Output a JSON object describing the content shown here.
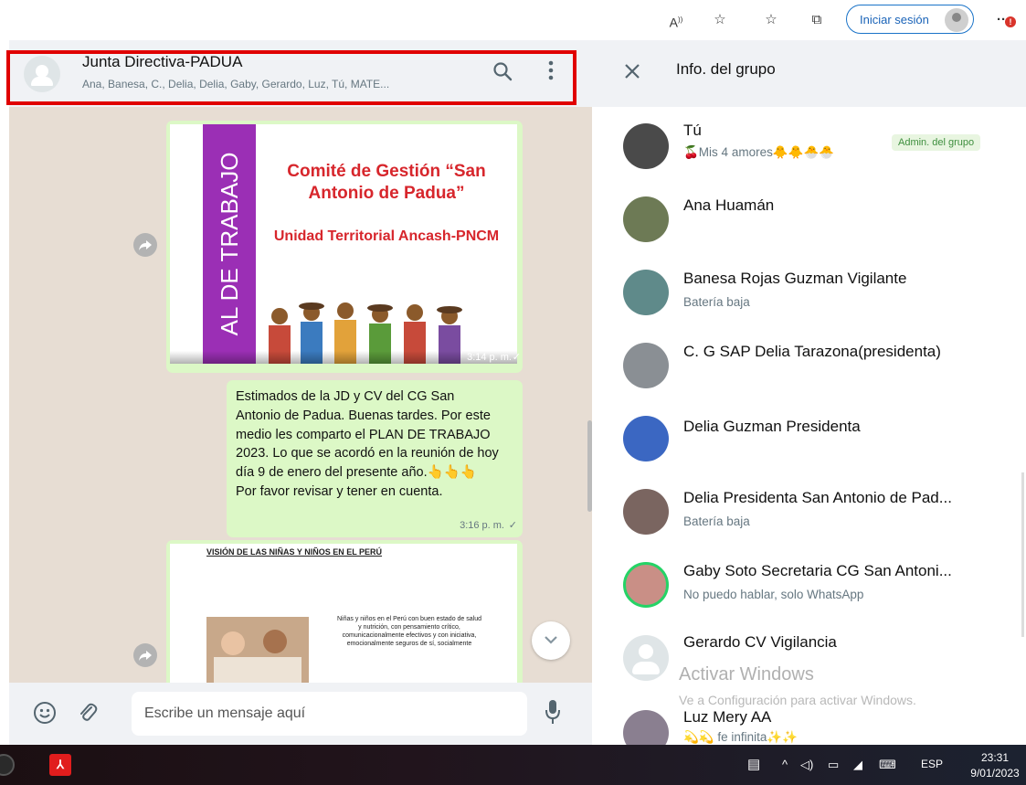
{
  "browser": {
    "login_label": "Iniciar sesión",
    "notification_badge": "!"
  },
  "chat": {
    "group_name": "Junta Directiva-PADUA",
    "members_line": "Ana, Banesa, C., Delia, Delia, Gaby, Gerardo, Luz, Tú, MATE..."
  },
  "messages": [
    {
      "type": "image",
      "slide_vertical_text": "AL DE TRABAJO",
      "slide_title": "Comité de Gestión “San Antonio de Padua”",
      "slide_subtitle": "Unidad Territorial Ancash-PNCM",
      "time": "3:14 p. m."
    },
    {
      "type": "text",
      "text": "Estimados de la JD y CV del CG San Antonio de Padua. Buenas tardes. Por este medio les comparto el PLAN DE TRABAJO 2023. Lo que se acordó en la reunión de hoy día 9 de enero del presente año.👆👆👆 Por favor revisar y tener en cuenta.",
      "time": "3:16 p. m."
    },
    {
      "type": "image",
      "slide_title": "VISIÓN DE LAS NIÑAS Y NIÑOS EN EL PERÚ",
      "slide_text": "Niñas y niños en el Perú con buen estado de salud y nutrición, con pensamiento crítico, comunicacionalmente efectivos y con iniciativa, emocionalmente seguros de sí, socialmente"
    }
  ],
  "input": {
    "placeholder": "Escribe un mensaje aquí"
  },
  "info_panel": {
    "title": "Info. del grupo",
    "admin_label": "Admin. del grupo",
    "members": [
      {
        "name": "Tú",
        "status": "🍒Mis 4 amores🐥🐥🐣🐣",
        "color": "#4a4a4a"
      },
      {
        "name": "Ana Huamán",
        "status": "",
        "color": "#6d7a55"
      },
      {
        "name": "Banesa Rojas Guzman Vigilante",
        "status": "Batería baja",
        "color": "#5f8a8a"
      },
      {
        "name": "C. G SAP Delia Tarazona(presidenta)",
        "status": "",
        "color": "#8a8f94"
      },
      {
        "name": "Delia Guzman Presidenta",
        "status": "",
        "color": "#3b67c2"
      },
      {
        "name": "Delia Presidenta San Antonio de Pad...",
        "status": "Batería baja",
        "color": "#7a6560"
      },
      {
        "name": "Gaby Soto Secretaria CG San Antoni...",
        "status": "No puedo hablar, solo WhatsApp",
        "color": "#c98f86"
      },
      {
        "name": "Gerardo CV Vigilancia",
        "status": "",
        "color": "#dfe5e7"
      },
      {
        "name": "Luz Mery AA",
        "status": "💫💫 fe infinita✨✨",
        "color": "#8a7f90"
      }
    ]
  },
  "watermark": {
    "line1": "Activar Windows",
    "line2": "Ve a Configuración para activar Windows."
  },
  "taskbar": {
    "lang": "ESP",
    "time": "23:31",
    "date": "9/01/2023"
  }
}
